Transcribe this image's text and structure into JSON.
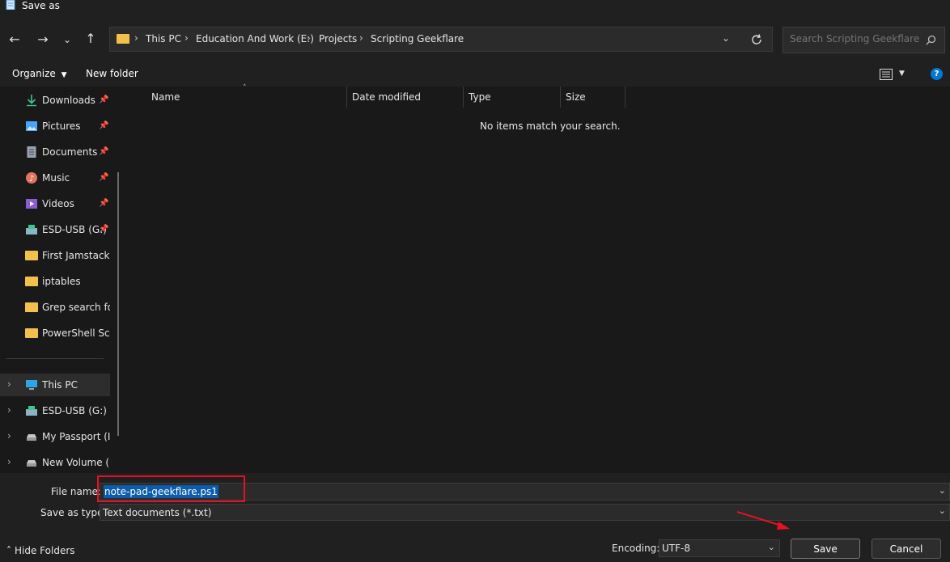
{
  "window": {
    "title": "Save as"
  },
  "address": {
    "crumbs": [
      "This PC",
      "Education And Work (E:)",
      "Projects",
      "Scripting Geekflare"
    ]
  },
  "search": {
    "placeholder": "Search Scripting Geekflare"
  },
  "toolbar": {
    "organize": "Organize",
    "new_folder": "New folder",
    "help": "?"
  },
  "sidebar": {
    "quick_access": [
      {
        "label": "Downloads",
        "icon": "download-icon",
        "pinned": true
      },
      {
        "label": "Pictures",
        "icon": "pictures-icon",
        "pinned": true
      },
      {
        "label": "Documents",
        "icon": "documents-icon",
        "pinned": true
      },
      {
        "label": "Music",
        "icon": "music-icon",
        "pinned": true
      },
      {
        "label": "Videos",
        "icon": "videos-icon",
        "pinned": true
      },
      {
        "label": "ESD-USB (G:)",
        "icon": "usb-drive-icon",
        "pinned": true
      },
      {
        "label": "First Jamstack w",
        "icon": "folder-icon",
        "pinned": false
      },
      {
        "label": "iptables",
        "icon": "folder-icon",
        "pinned": false
      },
      {
        "label": "Grep search for",
        "icon": "folder-icon",
        "pinned": false
      },
      {
        "label": "PowerShell Scrip",
        "icon": "folder-icon",
        "pinned": false
      }
    ],
    "drives": [
      {
        "label": "This PC",
        "icon": "monitor-icon"
      },
      {
        "label": "ESD-USB (G:)",
        "icon": "usb-drive-icon"
      },
      {
        "label": "My Passport (I:)",
        "icon": "drive-icon"
      },
      {
        "label": "New Volume (H:",
        "icon": "drive-icon"
      }
    ]
  },
  "columns": [
    "Name",
    "Date modified",
    "Type",
    "Size"
  ],
  "empty_message": "No items match your search.",
  "form": {
    "file_name_label": "File name:",
    "file_name_value": "note-pad-geekflare.ps1",
    "save_type_label": "Save as type:",
    "save_type_value": "Text documents (*.txt)",
    "encoding_label": "Encoding:",
    "encoding_value": "UTF-8"
  },
  "buttons": {
    "save": "Save",
    "cancel": "Cancel",
    "hide_folders": "Hide Folders"
  },
  "colors": {
    "accent": "#0078d4",
    "annotation": "#e81123",
    "selection": "#0b5cad"
  }
}
